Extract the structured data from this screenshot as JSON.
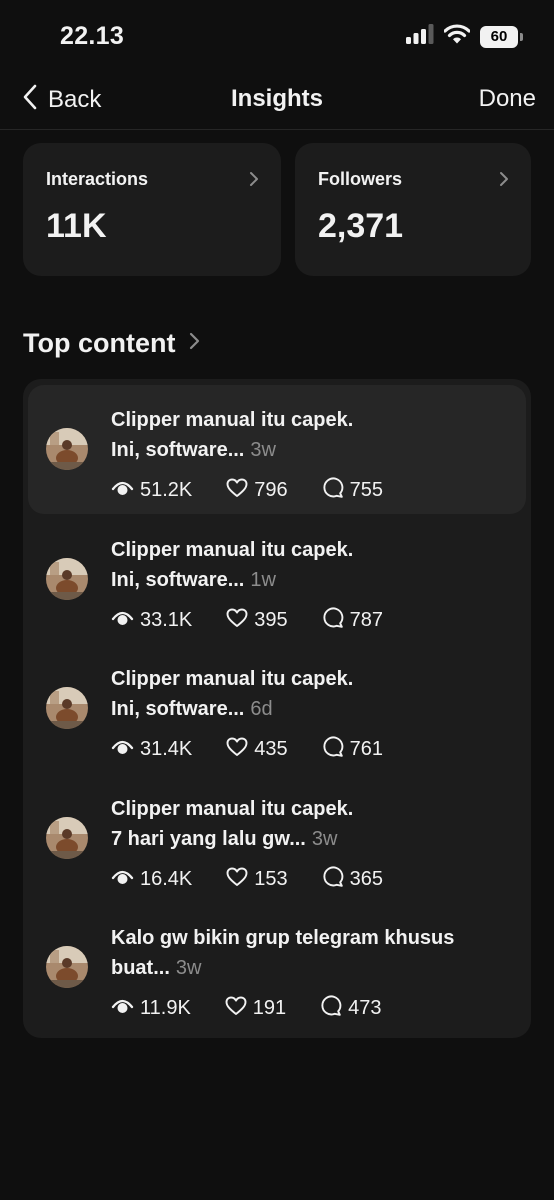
{
  "status_bar": {
    "time": "22.13",
    "battery": "60"
  },
  "nav": {
    "back_label": "Back",
    "title": "Insights",
    "done_label": "Done"
  },
  "stats": [
    {
      "label": "Interactions",
      "value": "11K"
    },
    {
      "label": "Followers",
      "value": "2,371"
    }
  ],
  "top_content": {
    "title": "Top content",
    "items": [
      {
        "line1": "Clipper manual itu capek.",
        "line2": "Ini, software...",
        "age": "3w",
        "views": "51.2K",
        "likes": "796",
        "replies": "755"
      },
      {
        "line1": "Clipper manual itu capek.",
        "line2": "Ini, software...",
        "age": "1w",
        "views": "33.1K",
        "likes": "395",
        "replies": "787"
      },
      {
        "line1": "Clipper manual itu capek.",
        "line2": "Ini, software...",
        "age": "6d",
        "views": "31.4K",
        "likes": "435",
        "replies": "761"
      },
      {
        "line1": "Clipper manual itu capek.",
        "line2": "7 hari yang lalu gw...",
        "age": "3w",
        "views": "16.4K",
        "likes": "153",
        "replies": "365"
      },
      {
        "line1": "Kalo gw bikin grup telegram khusus",
        "line2": "buat...",
        "age": "3w",
        "views": "11.9K",
        "likes": "191",
        "replies": "473"
      }
    ]
  },
  "icons": {
    "signal": "cellular-signal-icon",
    "wifi": "wifi-icon",
    "battery": "battery-icon",
    "back": "chevron-left-icon",
    "chevron": "chevron-right-icon",
    "views": "eye-icon",
    "likes": "heart-icon",
    "replies": "comment-bubble-icon"
  }
}
